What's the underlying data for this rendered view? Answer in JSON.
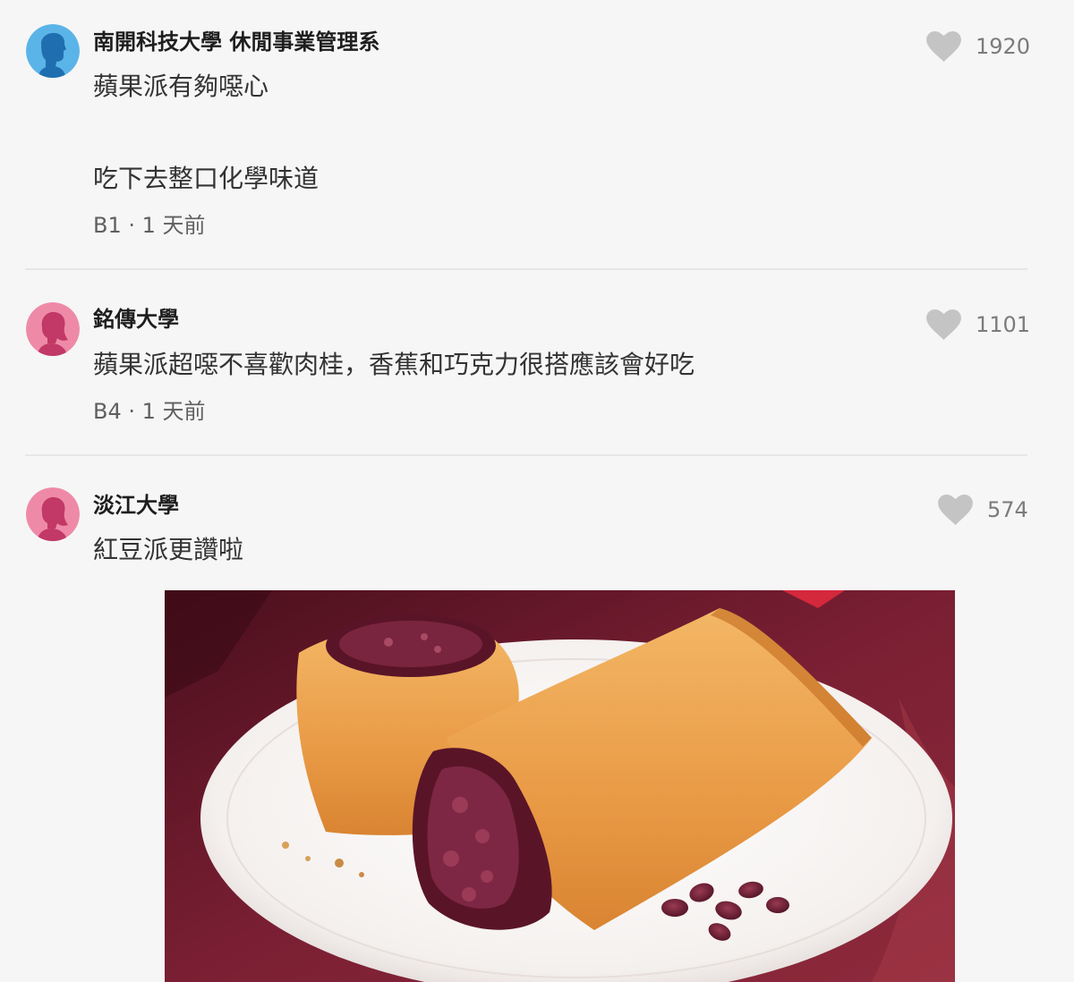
{
  "comments": [
    {
      "author": "南開科技大學 休閒事業管理系",
      "avatar_icon": "male-avatar-icon",
      "avatar_color": "#5ab4e8",
      "lines": [
        "蘋果派有夠噁心",
        "吃下去整口化學味道"
      ],
      "floor": "B1",
      "separator": "·",
      "time": "1 天前",
      "likes": "1920"
    },
    {
      "author": "銘傳大學",
      "avatar_icon": "female-avatar-icon",
      "avatar_color": "#ee8aa8",
      "lines": [
        "蘋果派超噁不喜歡肉桂，香蕉和巧克力很搭應該會好吃"
      ],
      "floor": "B4",
      "separator": "·",
      "time": "1 天前",
      "likes": "1101"
    },
    {
      "author": "淡江大學",
      "avatar_icon": "female-avatar-icon",
      "avatar_color": "#ee8aa8",
      "lines": [
        "紅豆派更讚啦"
      ],
      "likes": "574",
      "image": "red-bean-pie-photo"
    }
  ],
  "colors": {
    "background": "#f6f6f6",
    "heart": "#c4c4c4",
    "like_count": "#7b7b7b",
    "meta_text": "#5f5f5f",
    "divider": "#e7e7e7"
  },
  "icons": {
    "like": "heart-icon"
  }
}
